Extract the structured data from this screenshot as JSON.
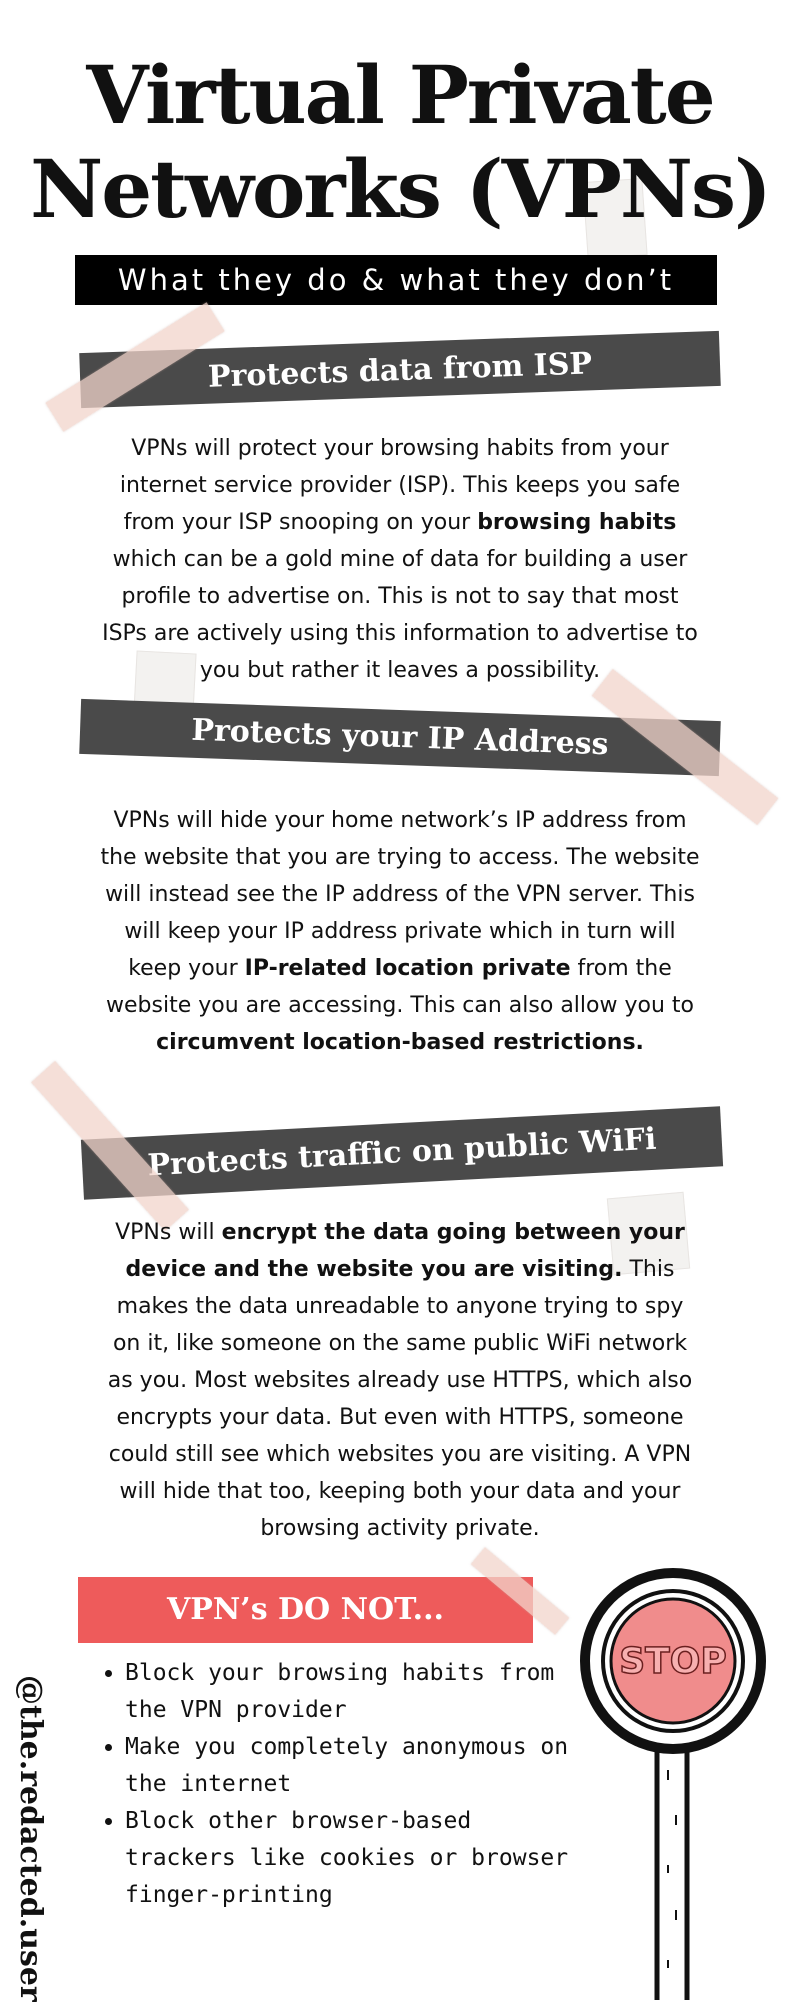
{
  "header": {
    "title_line1": "Virtual Private",
    "title_line2": "Networks (VPNs)",
    "subtitle": "What they do & what they don’t"
  },
  "sections": [
    {
      "heading": "Protects data from ISP",
      "text": [
        {
          "t": "VPNs will protect your browsing habits from your internet service provider (ISP). This keeps you safe from your ISP snooping on your ",
          "b": false
        },
        {
          "t": "browsing habits",
          "b": true
        },
        {
          "t": " which can be a gold mine of data for building a user profile to advertise on. This is not to say that most ISPs are actively using this information to advertise to you but rather it leaves a possibility.",
          "b": false
        }
      ]
    },
    {
      "heading": "Protects your IP Address",
      "text": [
        {
          "t": "VPNs will hide your home network’s IP address from the website that you are trying to access. The website will instead see the IP address of the VPN server. This will keep your IP address private which in turn will keep your ",
          "b": false
        },
        {
          "t": "IP-related location private",
          "b": true
        },
        {
          "t": " from the website you are accessing. This can also allow you to ",
          "b": false
        },
        {
          "t": "circumvent location-based restrictions.",
          "b": true
        }
      ]
    },
    {
      "heading": "Protects traffic on public WiFi",
      "text": [
        {
          "t": "VPNs will ",
          "b": false
        },
        {
          "t": "encrypt the data going between your device and the website you are visiting.",
          "b": true
        },
        {
          "t": " This makes the data unreadable to anyone trying to spy on it, like someone on the same public WiFi network as you. Most websites already use HTTPS, which also encrypts your data. But even with HTTPS, someone could still see which websites you are visiting. A VPN will hide that too, keeping both your data and your browsing activity private.",
          "b": false
        }
      ]
    }
  ],
  "donot": {
    "heading": "VPN’s DO NOT...",
    "items": [
      "Block your browsing habits  from the VPN provider",
      "Make you completely anonymous on the internet",
      "Block other browser-based trackers like cookies or browser finger-printing"
    ]
  },
  "sign_text": "STOP",
  "handle": "@the.redacted.user",
  "colors": {
    "banner": "#4a4a4a",
    "donot_bar": "#ee5b5b",
    "stop_fill": "#f08c8c",
    "tape": "#f1d4cb"
  }
}
